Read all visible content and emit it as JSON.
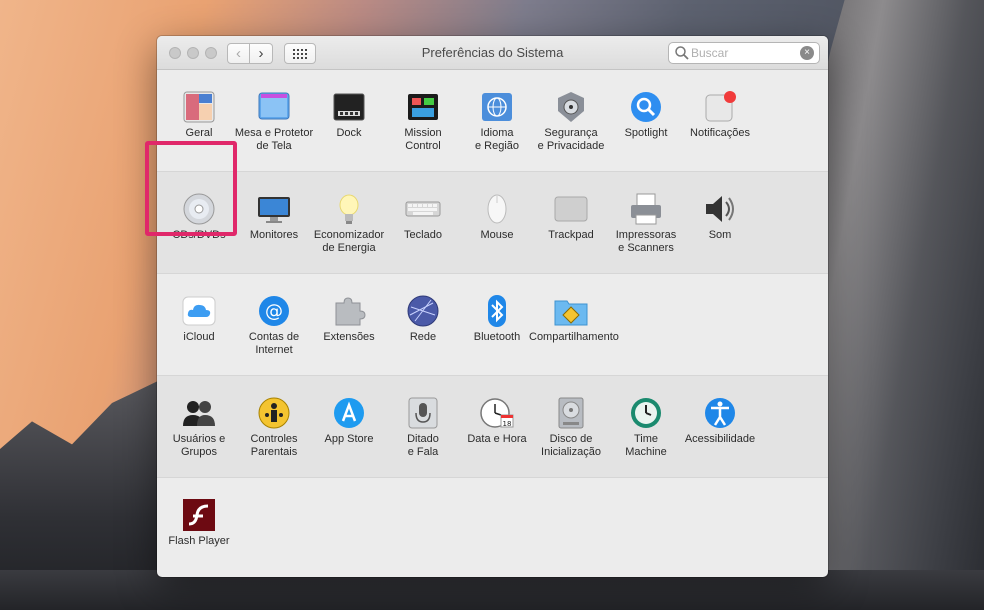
{
  "window": {
    "title": "Preferências do Sistema",
    "search": {
      "placeholder": "Buscar",
      "value": ""
    }
  },
  "sections": [
    [
      {
        "name": "geral",
        "label": "Geral",
        "icon": "general-icon"
      },
      {
        "name": "mesa-e-protetor",
        "label": "Mesa e Protetor\nde Tela",
        "icon": "desktop-screensaver-icon"
      },
      {
        "name": "dock",
        "label": "Dock",
        "icon": "dock-icon"
      },
      {
        "name": "mission-control",
        "label": "Mission\nControl",
        "icon": "mission-control-icon"
      },
      {
        "name": "idioma-e-regiao",
        "label": "Idioma\ne Região",
        "icon": "language-region-icon"
      },
      {
        "name": "seguranca",
        "label": "Segurança\ne Privacidade",
        "icon": "security-icon"
      },
      {
        "name": "spotlight",
        "label": "Spotlight",
        "icon": "spotlight-icon"
      },
      {
        "name": "notificacoes",
        "label": "Notificações",
        "icon": "notifications-icon"
      }
    ],
    [
      {
        "name": "cds-dvds",
        "label": "CDs/DVDs",
        "icon": "cd-dvd-icon"
      },
      {
        "name": "monitores",
        "label": "Monitores",
        "icon": "display-icon"
      },
      {
        "name": "economizador",
        "label": "Economizador\nde Energia",
        "icon": "lightbulb-icon"
      },
      {
        "name": "teclado",
        "label": "Teclado",
        "icon": "keyboard-icon"
      },
      {
        "name": "mouse",
        "label": "Mouse",
        "icon": "mouse-icon"
      },
      {
        "name": "trackpad",
        "label": "Trackpad",
        "icon": "trackpad-icon"
      },
      {
        "name": "impressoras",
        "label": "Impressoras\ne Scanners",
        "icon": "printer-icon"
      },
      {
        "name": "som",
        "label": "Som",
        "icon": "speaker-icon"
      }
    ],
    [
      {
        "name": "icloud",
        "label": "iCloud",
        "icon": "icloud-icon"
      },
      {
        "name": "contas-internet",
        "label": "Contas de\nInternet",
        "icon": "internet-accounts-icon"
      },
      {
        "name": "extensoes",
        "label": "Extensões",
        "icon": "extensions-icon"
      },
      {
        "name": "rede",
        "label": "Rede",
        "icon": "network-icon"
      },
      {
        "name": "bluetooth",
        "label": "Bluetooth",
        "icon": "bluetooth-icon"
      },
      {
        "name": "compartilhamento",
        "label": "Compartilhamento",
        "icon": "sharing-icon"
      }
    ],
    [
      {
        "name": "usuarios",
        "label": "Usuários e\nGrupos",
        "icon": "users-icon"
      },
      {
        "name": "controles-parentais",
        "label": "Controles\nParentais",
        "icon": "parental-controls-icon"
      },
      {
        "name": "app-store",
        "label": "App Store",
        "icon": "app-store-icon"
      },
      {
        "name": "ditado",
        "label": "Ditado\ne Fala",
        "icon": "microphone-icon"
      },
      {
        "name": "data-hora",
        "label": "Data e Hora",
        "icon": "clock-icon"
      },
      {
        "name": "disco-inicializacao",
        "label": "Disco de\nInicialização",
        "icon": "startup-disk-icon"
      },
      {
        "name": "time-machine",
        "label": "Time\nMachine",
        "icon": "time-machine-icon"
      },
      {
        "name": "acessibilidade",
        "label": "Acessibilidade",
        "icon": "accessibility-icon"
      }
    ],
    [
      {
        "name": "flash-player",
        "label": "Flash Player",
        "icon": "flash-icon"
      }
    ]
  ],
  "date_icon_day": "18",
  "highlighted_pane": "economizador",
  "colors": {
    "highlight": "#e0286a"
  }
}
